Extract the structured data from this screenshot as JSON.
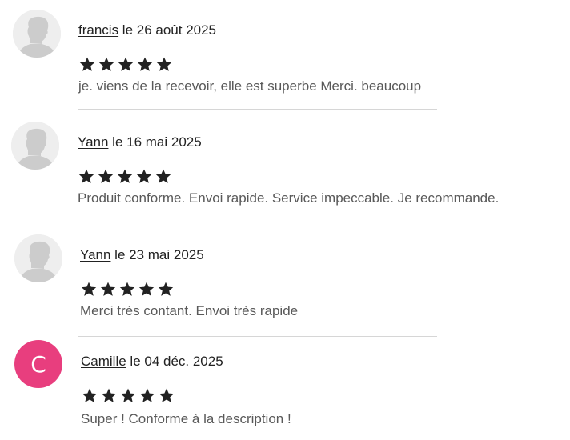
{
  "colors": {
    "text": "#222222",
    "comment_text": "#595959",
    "star": "#222222",
    "divider": "#d6d6d6",
    "avatar_letter_bg": "#e83e7e"
  },
  "reviews": [
    {
      "avatar_type": "default-avatar-icon",
      "author": "francis",
      "date_text": " le 26 août 2025",
      "rating": 5,
      "comment": "je. viens de la recevoir, elle est superbe Merci. beaucoup"
    },
    {
      "avatar_type": "default-avatar-icon",
      "author": "Yann",
      "date_text": " le 16 mai 2025",
      "rating": 5,
      "comment": "Produit conforme. Envoi rapide. Service impeccable. Je recommande."
    },
    {
      "avatar_type": "default-avatar-icon",
      "author": "Yann",
      "date_text": " le 23 mai 2025",
      "rating": 5,
      "comment": "Merci très contant. Envoi très rapide"
    },
    {
      "avatar_type": "letter-avatar",
      "avatar_letter": "C",
      "author": "Camille",
      "date_text": " le 04 déc. 2025",
      "rating": 5,
      "comment": "Super ! Conforme à la description !"
    }
  ]
}
